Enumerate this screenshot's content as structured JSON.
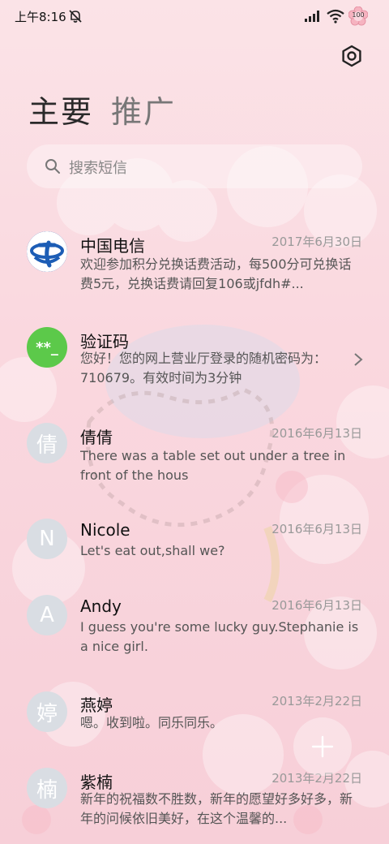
{
  "status_bar": {
    "time": "上午8:16",
    "battery": "100"
  },
  "header": {
    "tabs": [
      {
        "label": "主要",
        "active": true
      },
      {
        "label": "推广",
        "active": false
      }
    ]
  },
  "search": {
    "placeholder": "搜索短信"
  },
  "conversations": [
    {
      "name": "中国电信",
      "date": "2017年6月30日",
      "preview": "欢迎参加积分兑换话费活动，每500分可兑换话费5元，兑换话费请回复106或jfdh#...",
      "avatar": "telecom-logo"
    },
    {
      "name": "验证码",
      "date": "",
      "preview": "您好！您的网上营业厅登录的随机密码为：710679。有效时间为3分钟",
      "avatar": "**_"
    },
    {
      "name": "倩倩",
      "date": "2016年6月13日",
      "preview": "There was a table set out under a tree in front of the hous",
      "avatar": "倩"
    },
    {
      "name": "Nicole",
      "date": "2016年6月13日",
      "preview": "Let's eat out,shall we?",
      "avatar": "N"
    },
    {
      "name": "Andy",
      "date": "2016年6月13日",
      "preview": "I guess you're some lucky guy.Stephanie is a nice girl.",
      "avatar": "A"
    },
    {
      "name": "燕婷",
      "date": "2013年2月22日",
      "preview": "嗯。收到啦。同乐同乐。",
      "avatar": "婷"
    },
    {
      "name": "紫楠",
      "date": "2013年2月22日",
      "preview": "新年的祝福数不胜数，新年的愿望好多好多，新年的问候依旧美好，在这个温馨的...",
      "avatar": "楠"
    }
  ],
  "colors": {
    "background_top": "#fbe3e7",
    "background_bottom": "#f7cfd8",
    "verification_avatar": "#5cc94a",
    "telecom_blue": "#1c5db5",
    "contact_avatar": "#d9dde3"
  }
}
